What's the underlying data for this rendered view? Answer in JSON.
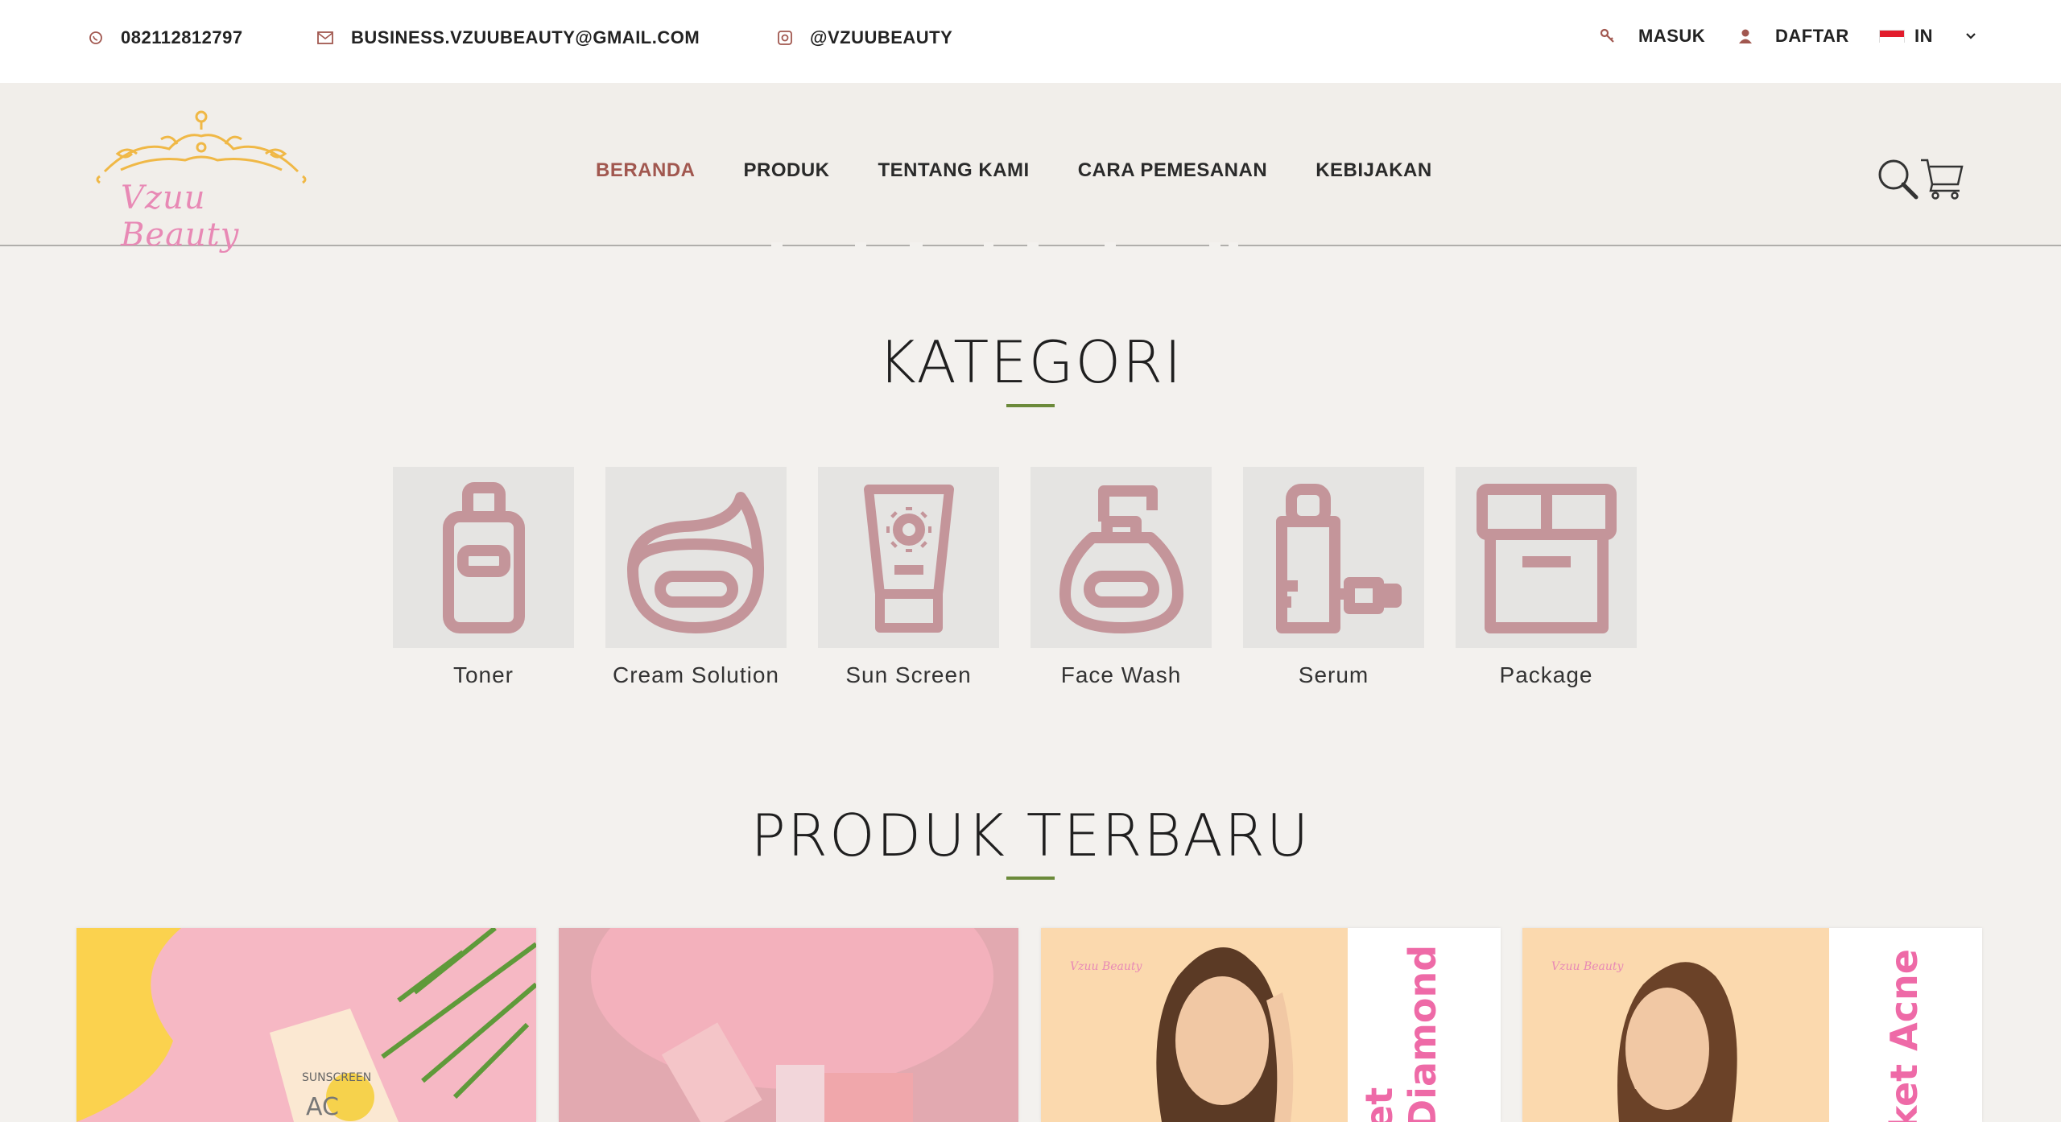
{
  "topbar": {
    "phone": "082112812797",
    "email": "BUSINESS.VZUUBEAUTY@GMAIL.COM",
    "instagram": "@VZUUBEAUTY",
    "login": "MASUK",
    "register": "DAFTAR",
    "language": "IN"
  },
  "header": {
    "logo_text": "Vzuu Beauty",
    "nav": [
      {
        "label": "BERANDA",
        "active": true
      },
      {
        "label": "PRODUK"
      },
      {
        "label": "TENTANG KAMI"
      },
      {
        "label": "CARA PEMESANAN"
      },
      {
        "label": "KEBIJAKAN"
      }
    ]
  },
  "kategori": {
    "title": "KATEGORI",
    "items": [
      {
        "label": "Toner",
        "icon": "toner-bottle-icon"
      },
      {
        "label": "Cream Solution",
        "icon": "cream-jar-icon"
      },
      {
        "label": "Sun Screen",
        "icon": "sunscreen-tube-icon"
      },
      {
        "label": "Face Wash",
        "icon": "face-wash-pump-icon"
      },
      {
        "label": "Serum",
        "icon": "serum-dropper-icon"
      },
      {
        "label": "Package",
        "icon": "package-box-icon"
      }
    ]
  },
  "produk": {
    "title": "PRODUK TERBARU",
    "cards": [
      {
        "caption": ""
      },
      {
        "caption": ""
      },
      {
        "caption": "et Diamond",
        "mini_logo": "Vzuu Beauty"
      },
      {
        "caption": "ket Acne",
        "mini_logo": "Vzuu Beauty"
      }
    ]
  },
  "colors": {
    "accent": "#a1574f",
    "icon": "#c4959a",
    "underline": "#6b8a3a"
  }
}
